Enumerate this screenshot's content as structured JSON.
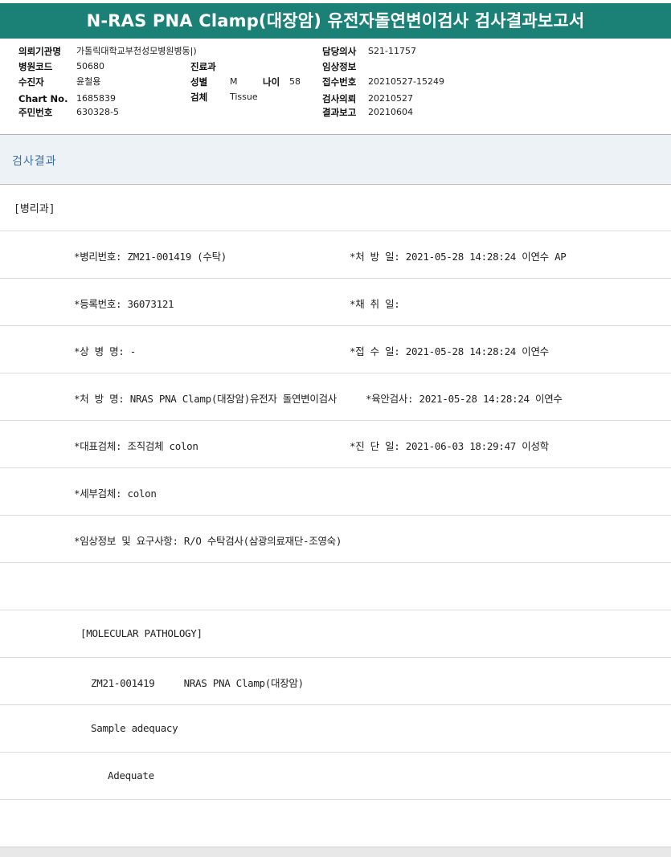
{
  "report_title": "N-RAS PNA Clamp(대장암) 유전자돌연변이검사 검사결과보고서",
  "patient_header": {
    "institution_label": "의뢰기관명",
    "institution_value": "가톨릭대학교부천성모병원병동|)",
    "hospital_code_label": "병원코드",
    "hospital_code_value": "50680",
    "recipient_label": "수진자",
    "recipient_value": "윤철용",
    "chart_no_label": "Chart No.",
    "chart_no_value": "1685839",
    "resident_no_label": "주민번호",
    "resident_no_value": "630328-5",
    "department_label": "진료과",
    "department_value": "",
    "sex_label": "성별",
    "sex_value": "M",
    "age_label": "나이",
    "age_value": "58",
    "specimen_label": "검체",
    "specimen_value": "Tissue",
    "physician_label": "담당의사",
    "physician_value": "S21-11757",
    "clinical_info_label": "임상정보",
    "clinical_info_value": "",
    "receipt_no_label": "접수번호",
    "receipt_no_value": "20210527-15249",
    "request_date_label": "검사의뢰",
    "request_date_value": "20210527",
    "report_date_label": "결과보고",
    "report_date_value": "20210604"
  },
  "section_title": "검사결과",
  "department_tag": "[병리과]",
  "result_rows": {
    "pathology_no": "*병리번호: ZM21-001419 (수탁)",
    "prescription_date": "*처 방 일: 2021-05-28 14:28:24  이연수 AP",
    "registration_no": "*등록번호: 36073121",
    "collection_date": "*채 취 일:",
    "disease_name": "*상 병 명: -",
    "receipt_date": "*접 수 일: 2021-05-28 14:28:24  이연수",
    "prescription_name": "*처 방 명: NRAS PNA Clamp(대장암)유전자 돌연변이검사",
    "gross_exam": "*육안검사: 2021-05-28 14:28:24  이연수",
    "representative_specimen": "*대표검체: 조직검체 colon",
    "diagnosis_date": "*진 단 일: 2021-06-03 18:29:47  이성학",
    "detail_specimen": "*세부검체: colon",
    "clinical_request": "*임상정보 및 요구사항: R/O 수탁검사(삼광의료재단-조영숙)"
  },
  "molecular": {
    "section_label": "[MOLECULAR PATHOLOGY]",
    "case_line": "ZM21-001419     NRAS PNA Clamp(대장암)",
    "adequacy_label": "Sample adequacy",
    "adequacy_value": "Adequate"
  },
  "colors": {
    "title_bar": "#1b8076",
    "section_bg": "#edf2f7",
    "section_text": "#3f6fa0"
  }
}
